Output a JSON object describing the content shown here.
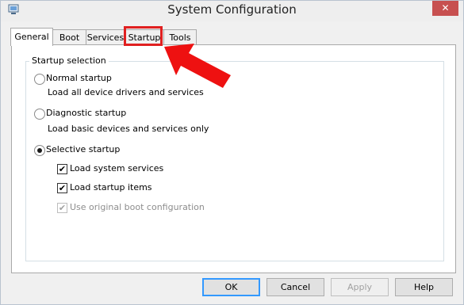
{
  "window": {
    "title": "System Configuration",
    "close_glyph": "✕"
  },
  "tabs": [
    {
      "label": "General",
      "selected": true
    },
    {
      "label": "Boot",
      "selected": false
    },
    {
      "label": "Services",
      "selected": false
    },
    {
      "label": "Startup",
      "selected": false
    },
    {
      "label": "Tools",
      "selected": false
    }
  ],
  "startup_selection": {
    "group_label": "Startup selection",
    "normal": {
      "label": "Normal startup",
      "description": "Load all device drivers and services",
      "checked": false
    },
    "diagnostic": {
      "label": "Diagnostic startup",
      "description": "Load basic devices and services only",
      "checked": false
    },
    "selective": {
      "label": "Selective startup",
      "checked": true
    },
    "options": [
      {
        "label": "Load system services",
        "checked": true,
        "enabled": true
      },
      {
        "label": "Load startup items",
        "checked": true,
        "enabled": true
      },
      {
        "label": "Use original boot configuration",
        "checked": true,
        "enabled": false
      }
    ]
  },
  "buttons": {
    "ok": "OK",
    "cancel": "Cancel",
    "apply": "Apply",
    "help": "Help"
  },
  "colors": {
    "highlight": "#e02020",
    "arrow": "#ee1111"
  },
  "icons": {
    "title": "msconfig-icon",
    "check": "✔"
  }
}
